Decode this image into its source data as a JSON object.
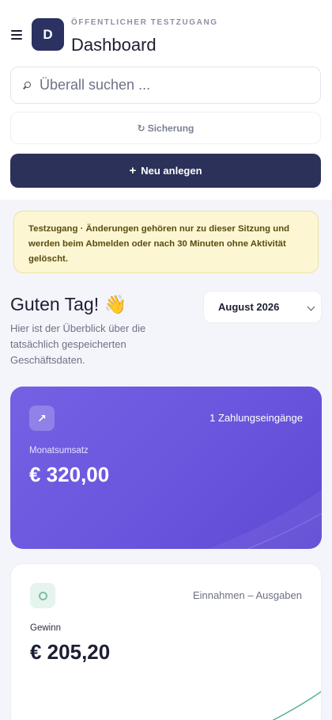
{
  "header": {
    "org": "ÖFFENTLICHER TESTZUGANG",
    "title": "Dashboard",
    "logo_letter": "D"
  },
  "search": {
    "placeholder": "Überall suchen ..."
  },
  "backup": {
    "icon": "↻",
    "label": "Sicherung"
  },
  "new_button": {
    "icon": "+",
    "label": "Neu anlegen"
  },
  "notice": "Testzugang · Änderungen gehören nur zu dieser Sitzung und werden beim Abmelden oder nach 30 Minuten ohne Aktivität gelöscht.",
  "greeting": "Guten Tag! 👋",
  "subtitle": "Hier ist der Überblick über die tatsächlich gespeicherten Geschäftsdaten.",
  "month": "August 2026",
  "revenue_card": {
    "icon": "↗",
    "count": "1 Zahlungseingänge",
    "label": "Monatsumsatz",
    "amount": "€ 320,00"
  },
  "profit_card": {
    "subtitle": "Einnahmen – Ausgaben",
    "label": "Gewinn",
    "amount": "€ 205,20"
  },
  "colors": {
    "brand": "#2b3160",
    "revenue_card": "#6a55de",
    "notice_bg": "#fcf7d2",
    "profit_line": "#4fb488"
  }
}
